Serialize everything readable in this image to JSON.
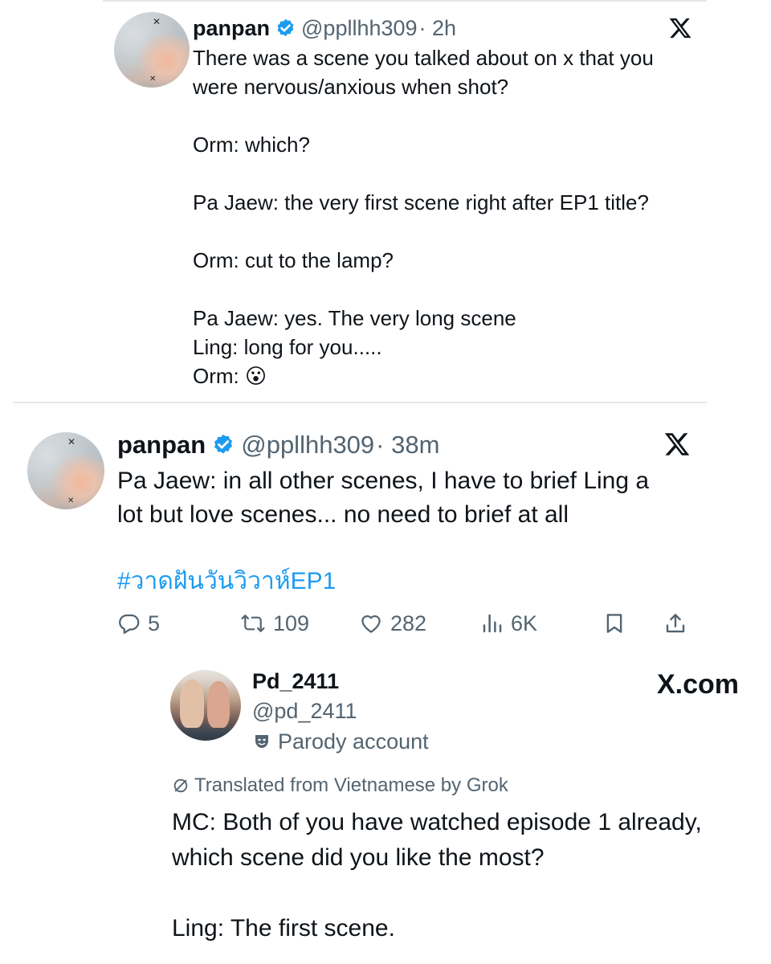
{
  "tweet1": {
    "name": "panpan",
    "handle": "@ppllhh309",
    "time": "· 2h",
    "text": "There was a scene you talked about on x that you\nwere nervous/anxious when shot?\n\nOrm: which?\n\nPa Jaew: the very first scene right after EP1 title?\n\nOrm: cut to the lamp?\n\nPa Jaew: yes. The very long scene\nLing: long for you.....\nOrm: ",
    "emoji": "😮"
  },
  "tweet2": {
    "name": "panpan",
    "handle": "@ppllhh309",
    "time": "· 38m",
    "text": "Pa Jaew: in all other scenes, I have to brief Ling a\nlot but love scenes... no need to brief at all",
    "hashtag": "#วาดฝันวันวิวาห์EP1",
    "actions": {
      "replies": "5",
      "reposts": "109",
      "likes": "282",
      "views": "6K"
    }
  },
  "quote": {
    "name": "Pd_2411",
    "handle": "@pd_2411",
    "label": "Parody account",
    "site": "X.com",
    "translated": "Translated from Vietnamese by Grok",
    "text": "MC: Both of you have watched episode 1 already,\nwhich scene did you like the most?\n\nLing: The first scene."
  },
  "colors": {
    "text": "#0f1419",
    "secondary": "#536471",
    "accent": "#1d9bf0",
    "divider": "#e6e9ec"
  },
  "icons": [
    "verified-badge-icon",
    "x-logo-icon",
    "reply-icon",
    "repost-icon",
    "like-icon",
    "views-icon",
    "bookmark-icon",
    "share-icon",
    "parody-mask-icon",
    "translate-icon"
  ]
}
